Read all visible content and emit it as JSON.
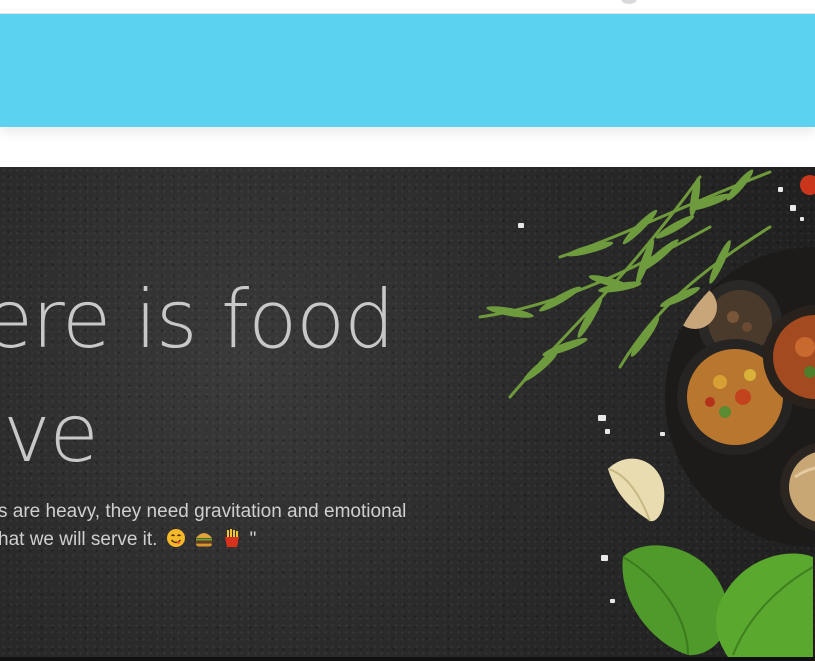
{
  "header": {
    "nav_color": "#5bd3f0"
  },
  "hero": {
    "headline_line1": "here is food",
    "headline_line2": "love",
    "tagline_line1": "s are heavy, they need gravitation and emotional",
    "tagline_line2": "hat we will serve it.",
    "tagline_end": "\"",
    "emojis": [
      "smiling-face-emoji",
      "burger-emoji",
      "fries-emoji"
    ],
    "text_color": "#c8c8c8",
    "background_color": "#2b2b2b"
  }
}
